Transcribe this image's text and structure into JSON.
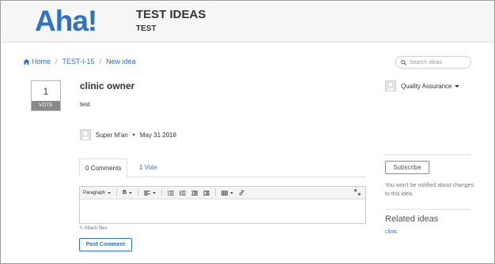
{
  "header": {
    "logo_text": "Aha!",
    "title": "TEST IDEAS",
    "subtitle": "TEST"
  },
  "breadcrumb": {
    "home": "Home",
    "item": "TEST-I-15",
    "current": "New idea"
  },
  "search": {
    "placeholder": "Search ideas"
  },
  "idea": {
    "votes": "1",
    "vote_label": "VOTE",
    "title": "clinic owner",
    "description": "test",
    "author": "Super M'an",
    "date": "May 31 2018",
    "assignee": "Quality Assurance"
  },
  "tabs": [
    {
      "label": "0 Comments"
    },
    {
      "label": "1 Vote"
    }
  ],
  "editor": {
    "paragraph_label": "Paragraph",
    "bold_label": "B",
    "attach_label": "Attach files",
    "post_label": "Post Comment"
  },
  "sidebar": {
    "subscribe_label": "Subscribe",
    "notify_text": "You won't be notified about changes to this idea.",
    "related_title": "Related ideas",
    "related_items": [
      "clinic"
    ]
  },
  "colors": {
    "brand": "#2d72c9",
    "vote_label_bg": "#8a8a8a",
    "header_bg": "#f6f6f6"
  }
}
